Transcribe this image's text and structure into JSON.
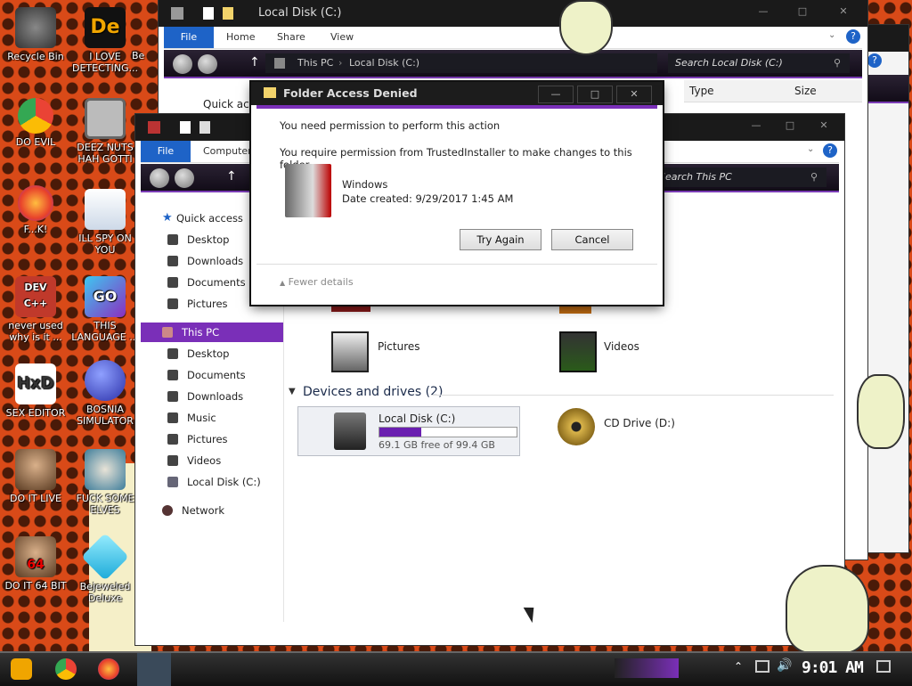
{
  "desktop": {
    "icons": [
      {
        "label": "Recycle Bin"
      },
      {
        "label": "I LOVE DETECTING..."
      },
      {
        "label": "Be"
      },
      {
        "label": "DO EVIL"
      },
      {
        "label": "DEEZ NUTS HAH GOTTI"
      },
      {
        "label": "F...K!"
      },
      {
        "label": "ILL SPY ON YOU"
      },
      {
        "label": "never used why is it ..."
      },
      {
        "label": "THIS LANGUAGE ..."
      },
      {
        "label": "SEX EDITOR"
      },
      {
        "label": "BOSNIA SIMULATOR"
      },
      {
        "label": "DO IT LIVE"
      },
      {
        "label": "FUCK SOME ELVES"
      },
      {
        "label": "DO IT 64 BIT"
      },
      {
        "label": "Bejeweled Deluxe"
      }
    ],
    "icon_glyphs": {
      "de": "De",
      "devcpp": "DEV\nC++",
      "go": "GO",
      "hxd": "HxD",
      "64": "64"
    }
  },
  "back_window": {
    "title": "Local Disk (C:)",
    "tabs": [
      "File",
      "Home",
      "Share",
      "View"
    ],
    "path": [
      "This PC",
      "Local Disk (C:)"
    ],
    "search_placeholder": "Search Local Disk (C:)",
    "columns": [
      "Type",
      "Size"
    ],
    "quick_access_partial": "Quick acc"
  },
  "front_window": {
    "tabs": [
      "File",
      "Computer"
    ],
    "search_placeholder": "Search This PC",
    "nav": [
      {
        "label": "Quick access",
        "icon": "star-icon"
      },
      {
        "label": "Desktop",
        "icon": "desktop-icon"
      },
      {
        "label": "Downloads",
        "icon": "downloads-icon"
      },
      {
        "label": "Documents",
        "icon": "documents-icon"
      },
      {
        "label": "Pictures",
        "icon": "pictures-icon"
      },
      {
        "label": "This PC",
        "icon": "computer-icon"
      },
      {
        "label": "Desktop",
        "icon": "desktop-icon"
      },
      {
        "label": "Documents",
        "icon": "documents-icon"
      },
      {
        "label": "Downloads",
        "icon": "downloads-icon"
      },
      {
        "label": "Music",
        "icon": "music-icon"
      },
      {
        "label": "Pictures",
        "icon": "pictures-icon"
      },
      {
        "label": "Videos",
        "icon": "videos-icon"
      },
      {
        "label": "Local Disk (C:)",
        "icon": "drive-icon"
      },
      {
        "label": "Network",
        "icon": "network-icon"
      }
    ],
    "folders": [
      {
        "label": "Pictures"
      },
      {
        "label": "Videos"
      }
    ],
    "devices_header": "Devices and drives (2)",
    "drive": {
      "label": "Local Disk (C:)",
      "free_text": "69.1 GB free of 99.4 GB",
      "used_fraction": 0.305
    },
    "cd_drive": {
      "label": "CD Drive (D:)"
    }
  },
  "dialog": {
    "title": "Folder Access Denied",
    "line1": "You need permission to perform this action",
    "line2": "You require permission from TrustedInstaller to make changes to this folder",
    "item_name": "Windows",
    "date_created": "Date created: 9/29/2017 1:45 AM",
    "try_again": "Try Again",
    "cancel": "Cancel",
    "fewer_details": "Fewer details"
  },
  "taskbar": {
    "clock": "9:01 AM"
  },
  "colors": {
    "accent_purple": "#7a2fb8",
    "file_tab_blue": "#1e63c7",
    "drive_bar": "#6a1fb0"
  }
}
